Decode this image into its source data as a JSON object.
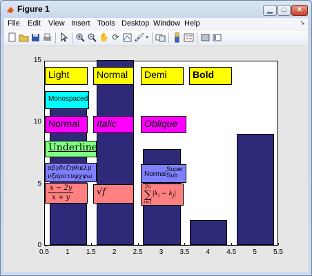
{
  "window": {
    "title": "Figure 1"
  },
  "menu": [
    "File",
    "Edit",
    "View",
    "Insert",
    "Tools",
    "Desktop",
    "Window",
    "Help"
  ],
  "toolbar_icons": [
    "new-figure-icon",
    "open-file-icon",
    "save-icon",
    "print-icon",
    "edit-plot-arrow-icon",
    "zoom-in-icon",
    "zoom-out-icon",
    "pan-hand-icon",
    "rotate-3d-icon",
    "data-cursor-icon",
    "brush-icon",
    "link-plot-icon",
    "colorbar-icon",
    "legend-icon",
    "hide-plot-tools-icon",
    "show-plot-tools-icon"
  ],
  "chart_data": {
    "type": "bar",
    "x": [
      1,
      2,
      3,
      4,
      5
    ],
    "values": [
      12,
      15,
      7.8,
      2,
      9
    ],
    "xlim": [
      0.5,
      5.5
    ],
    "ylim": [
      0,
      15
    ],
    "xticks": [
      "0.5",
      "1",
      "1.5",
      "2",
      "2.5",
      "3",
      "3.5",
      "4",
      "4.5",
      "5",
      "5.5"
    ],
    "yticks": [
      "0",
      "5",
      "10",
      "15"
    ],
    "bar_color": "#2e2a79",
    "annotations": {
      "light": "Light",
      "normal": "Normal",
      "demi": "Demi",
      "bold": "Bold",
      "monospaced": "Monospaced",
      "normal2": "Normal",
      "italic": "Italic",
      "oblique": "Oblique",
      "underline": "Underline",
      "greek1": "αβγδεζηθικλμ",
      "greek2": "νξπρστυφχψω",
      "frac_num": "x − 2y",
      "frac_den": "x + y",
      "sqrt": "√f",
      "normal_sub_super": "Normal",
      "super": "Super",
      "sub": "Sub",
      "sum_top": "2n",
      "sum_bottom": "i=1",
      "sum_body": "|k",
      "sum_i": "i",
      "sum_mid": " − k",
      "sum_j": "j",
      "sum_end": "|"
    }
  }
}
